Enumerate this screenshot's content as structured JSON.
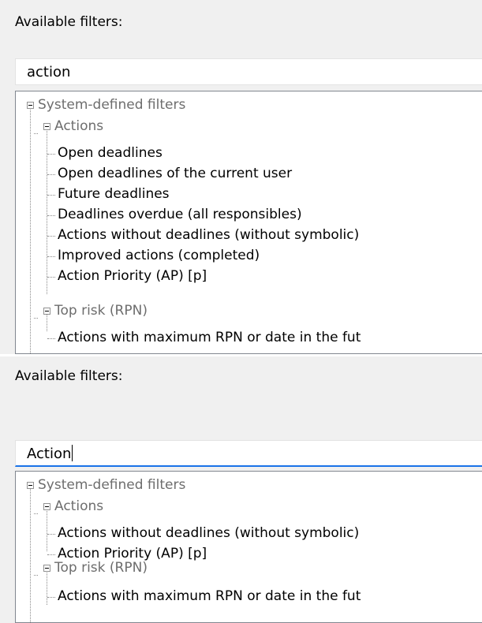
{
  "top": {
    "title": "Available filters:",
    "search_value": "action",
    "tree": {
      "root": "System-defined filters",
      "groups": [
        {
          "label": "Actions",
          "items": [
            "Open deadlines",
            "Open deadlines of the current user",
            "Future deadlines",
            "Deadlines overdue (all responsibles)",
            "Actions without deadlines (without symbolic)",
            "Improved actions (completed)",
            "Action Priority (AP) [p]"
          ]
        },
        {
          "label": "Top risk (RPN)",
          "items": [
            "Actions with maximum RPN or date in the fut"
          ]
        }
      ]
    }
  },
  "bottom": {
    "title": "Available filters:",
    "search_value": "Action",
    "tree": {
      "root": "System-defined filters",
      "groups": [
        {
          "label": "Actions",
          "items": [
            "Actions without deadlines (without symbolic)",
            "Action Priority (AP) [p]"
          ]
        },
        {
          "label": "Top risk (RPN)",
          "items": [
            "Actions with maximum RPN or date in the fut"
          ]
        }
      ]
    }
  },
  "colors": {
    "panel_background": "#f0f0f0",
    "folder_text": "#6d6d6d",
    "focus_underline": "#1a73e8",
    "tree_border": "#828790"
  }
}
